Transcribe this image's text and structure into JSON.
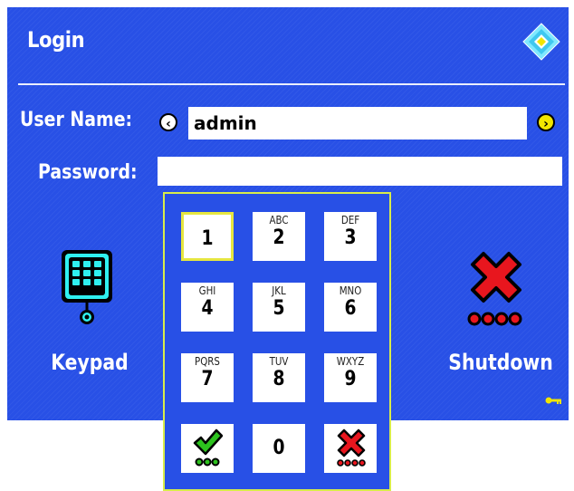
{
  "window": {
    "title": "Login"
  },
  "form": {
    "username_label": "User Name:",
    "username_value": "admin",
    "password_label": "Password:",
    "password_value": ""
  },
  "actions": {
    "keypad_label": "Keypad",
    "shutdown_label": "Shutdown"
  },
  "keypad": {
    "keys": [
      {
        "digit": "1",
        "letters": ""
      },
      {
        "digit": "2",
        "letters": "ABC"
      },
      {
        "digit": "3",
        "letters": "DEF"
      },
      {
        "digit": "4",
        "letters": "GHI"
      },
      {
        "digit": "5",
        "letters": "JKL"
      },
      {
        "digit": "6",
        "letters": "MNO"
      },
      {
        "digit": "7",
        "letters": "PQRS"
      },
      {
        "digit": "8",
        "letters": "TUV"
      },
      {
        "digit": "9",
        "letters": "WXYZ"
      },
      {
        "digit": "0",
        "letters": ""
      }
    ],
    "confirm_icon": "check-icon",
    "cancel_icon": "cancel-x-icon"
  },
  "icons": {
    "logo": "diamond-logo-icon",
    "prev": "arrow-left-icon",
    "next": "arrow-right-icon",
    "keypad": "keypad-icon",
    "shutdown": "shutdown-x-icon",
    "key": "key-icon"
  },
  "colors": {
    "background": "#2850e6",
    "accent_yellow": "#f2e600",
    "shutdown_red": "#e8161e",
    "confirm_green": "#2dc21e",
    "keypad_cyan": "#2ff0f0"
  }
}
